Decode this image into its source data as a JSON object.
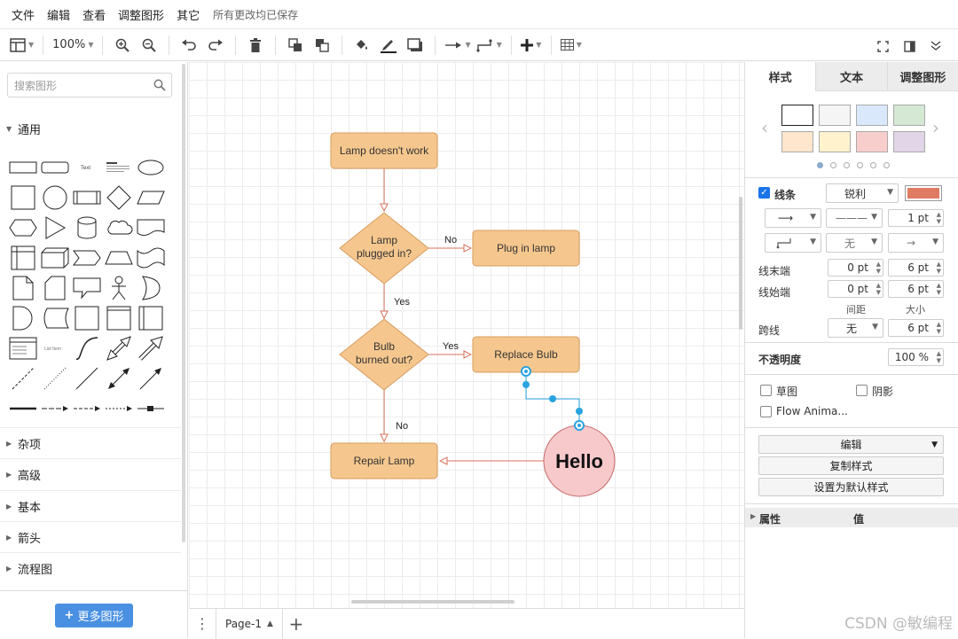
{
  "menubar": {
    "items": [
      "文件",
      "编辑",
      "查看",
      "调整图形",
      "其它"
    ],
    "saved_status": "所有更改均已保存"
  },
  "toolbar": {
    "zoom": "100%"
  },
  "left_panel": {
    "search_placeholder": "搜索图形",
    "general_label": "通用",
    "sections": [
      "杂项",
      "高级",
      "基本",
      "箭头",
      "流程图"
    ],
    "more_shapes": "更多图形"
  },
  "diagram": {
    "nodes": {
      "lamp": "Lamp doesn't work",
      "plugged": [
        "Lamp",
        "plugged in?"
      ],
      "plug_in": "Plug in lamp",
      "bulb": [
        "Bulb",
        "burned out?"
      ],
      "replace": "Replace Bulb",
      "repair": "Repair Lamp",
      "hello": "Hello"
    },
    "edge_labels": {
      "no1": "No",
      "yes1": "Yes",
      "yes2": "Yes",
      "no2": "No"
    },
    "colors": {
      "process_fill": "#f5c78e",
      "process_stroke": "#d89b5e",
      "edge": "#d9705a",
      "hello_fill": "#f8c9cb",
      "hello_stroke": "#c66a6a",
      "selection": "#29a3e0"
    }
  },
  "pagebar": {
    "page_name": "Page-1"
  },
  "right_panel": {
    "tabs": [
      "样式",
      "文本",
      "调整图形"
    ],
    "swatches": [
      "#ffffff",
      "#f5f5f5",
      "#dae8fc",
      "#d5e8d4",
      "#ffe6cc",
      "#fff2cc",
      "#f8cecc",
      "#e1d5e7"
    ],
    "line_label": "线条",
    "line_style": "锐利",
    "line_color": "#e07b63",
    "line_width": "1 pt",
    "waypoint_none": "无",
    "line_end_label": "线末端",
    "line_start_label": "线始端",
    "end_spacing": "0 pt",
    "end_size": "6 pt",
    "start_spacing": "0 pt",
    "start_size": "6 pt",
    "spacing_label": "间距",
    "size_label": "大小",
    "jump_label": "跨线",
    "jump_value": "无",
    "jump_size": "6 pt",
    "opacity_label": "不透明度",
    "opacity_value": "100 %",
    "sketch_label": "草图",
    "shadow_label": "阴影",
    "flow_label": "Flow Anima...",
    "edit_label": "编辑",
    "copy_style": "复制样式",
    "set_default": "设置为默认样式",
    "property_label": "属性",
    "value_label": "值"
  },
  "watermark": "CSDN @敏编程"
}
